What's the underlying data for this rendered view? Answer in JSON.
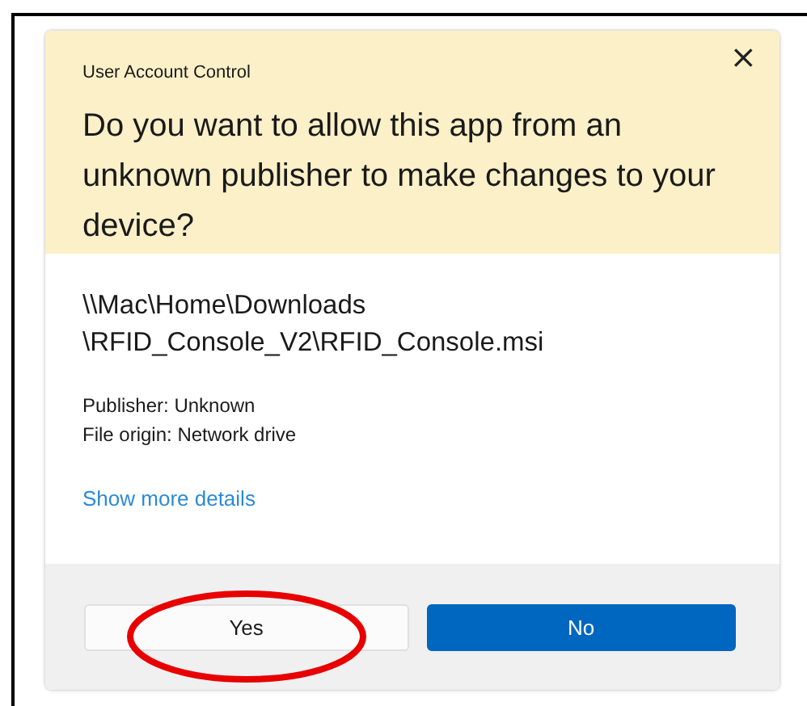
{
  "dialog": {
    "title": "User Account Control",
    "close": "×",
    "question": "Do you want to allow this app from an unknown publisher to make changes to your device?",
    "path_lines": [
      "\\\\Mac\\Home\\Downloads",
      "\\RFID_Console_V2\\RFID_Console.msi"
    ],
    "details": [
      "Publisher: Unknown",
      "File origin: Network drive"
    ],
    "link": "Show more details",
    "buttons": [
      {
        "label": "Yes",
        "kind": "secondary",
        "circled": true
      },
      {
        "label": "No",
        "kind": "primary",
        "circled": false
      }
    ]
  }
}
